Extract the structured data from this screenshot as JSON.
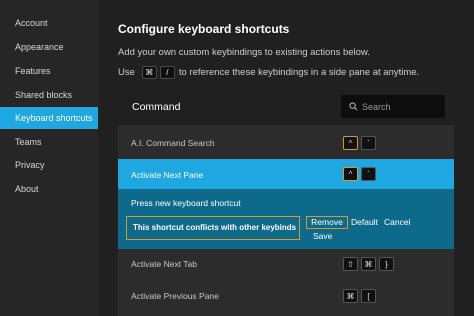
{
  "sidebar": {
    "items": [
      {
        "label": "Account"
      },
      {
        "label": "Appearance"
      },
      {
        "label": "Features"
      },
      {
        "label": "Shared blocks"
      },
      {
        "label": "Keyboard shortcuts"
      },
      {
        "label": "Teams"
      },
      {
        "label": "Privacy"
      },
      {
        "label": "About"
      }
    ]
  },
  "main": {
    "title": "Configure keyboard shortcuts",
    "desc_line1": "Add your own custom keybindings to existing actions below.",
    "desc_line2_prefix": "Use",
    "desc_key1": "⌘",
    "desc_key2": "/",
    "desc_line2_suffix": "to reference these keybindings in a side pane at anytime.",
    "command_header": "Command",
    "search_placeholder": "Search"
  },
  "commands": [
    {
      "label": "A.I. Command Search",
      "keys": [
        "^",
        "`"
      ]
    },
    {
      "label": "Activate Next Pane",
      "keys": [
        "^",
        "`"
      ]
    },
    {
      "label": "Activate Next Tab",
      "keys": [
        "⇧",
        "⌘",
        "}"
      ]
    },
    {
      "label": "Activate Previous Pane",
      "keys": [
        "⌘",
        "["
      ]
    }
  ],
  "editor": {
    "prompt": "Press new keyboard shortcut",
    "conflict": "This shortcut conflicts with other keybinds",
    "remove": "Remove",
    "save": "Save",
    "default": "Default",
    "cancel": "Cancel"
  },
  "colors": {
    "accent": "#1ea7e1",
    "highlight": "#d59a2c",
    "edit_bg": "#0e6a8a"
  }
}
